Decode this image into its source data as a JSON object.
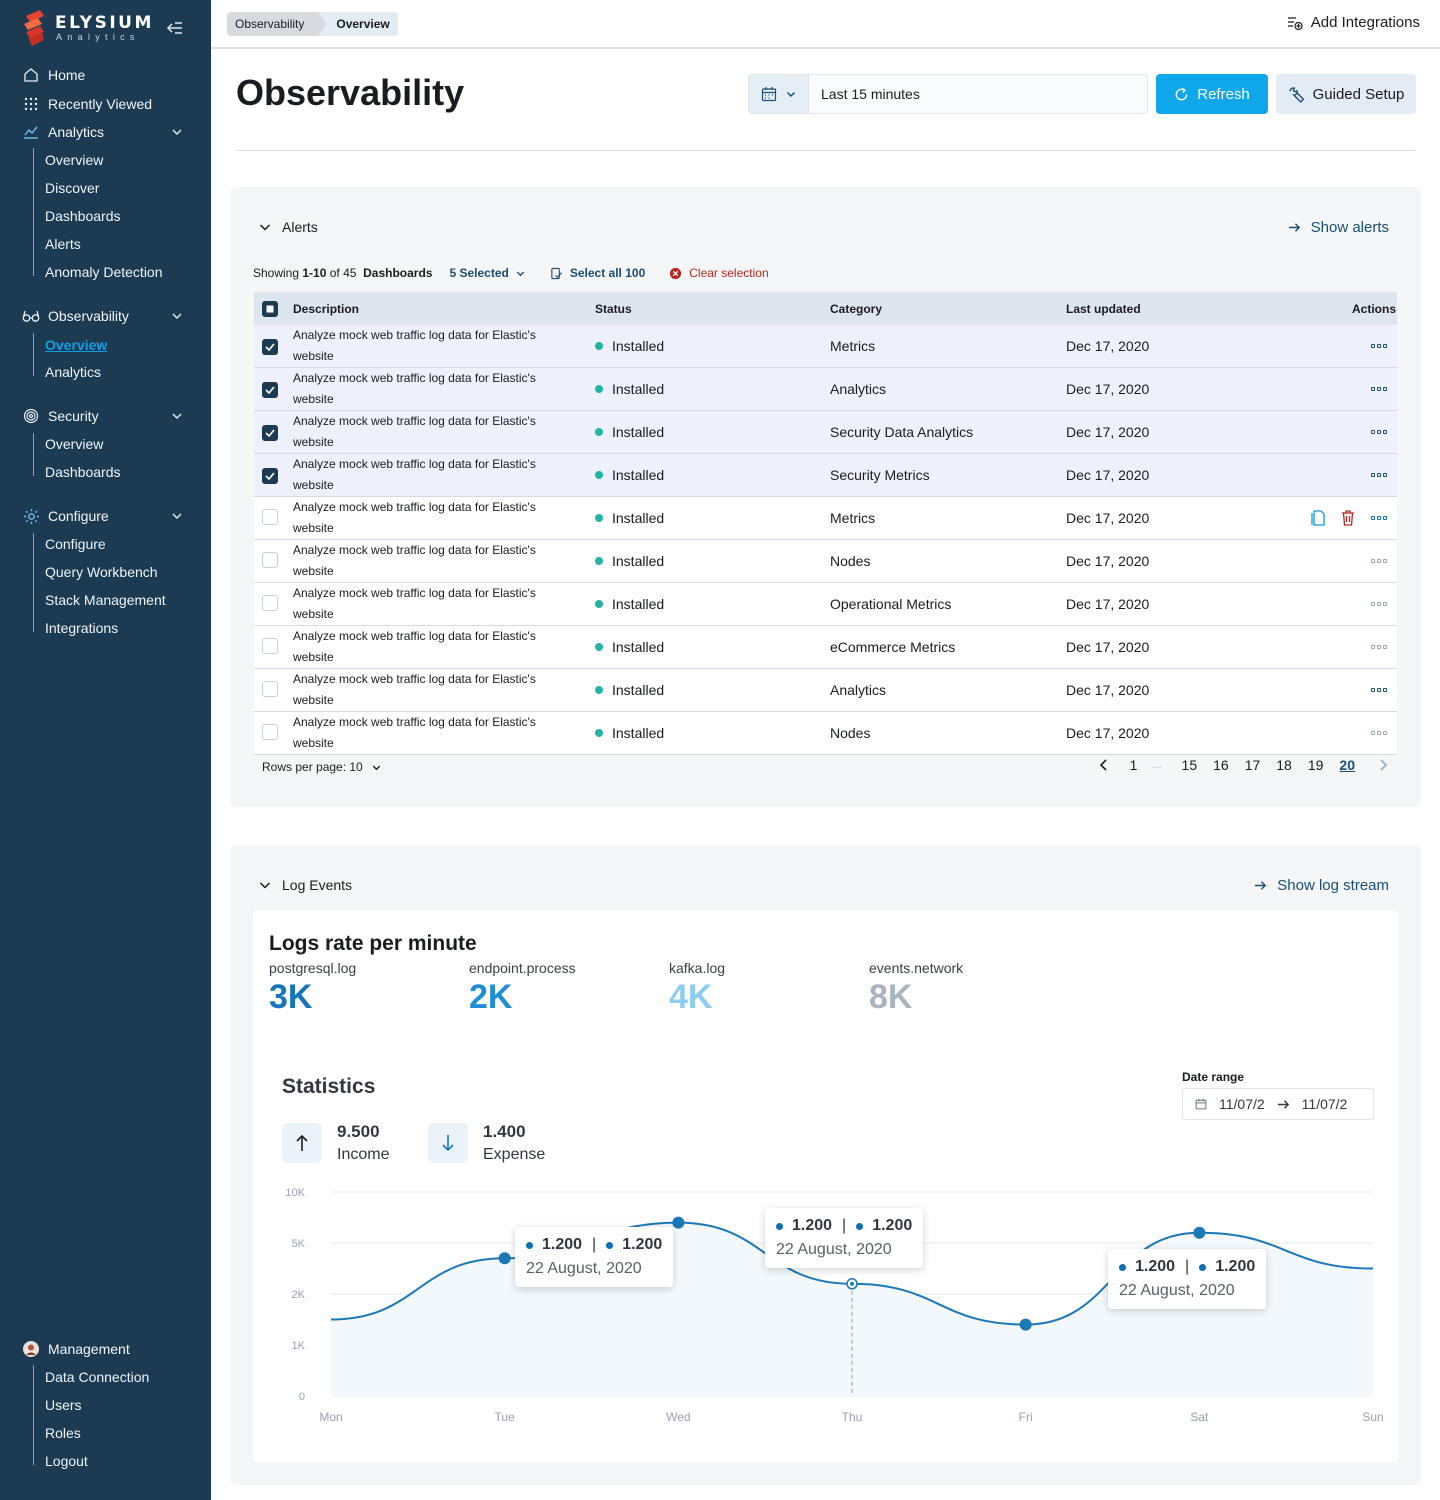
{
  "brand": {
    "name": "ELYSIUM",
    "sub": "Analytics"
  },
  "sidebar": {
    "home": "Home",
    "recent": "Recently Viewed",
    "analytics": {
      "label": "Analytics",
      "items": [
        "Overview",
        "Discover",
        "Dashboards",
        "Alerts",
        "Anomaly Detection"
      ]
    },
    "observability": {
      "label": "Observability",
      "items": [
        "Overview",
        "Analytics"
      ]
    },
    "security": {
      "label": "Security",
      "items": [
        "Overview",
        "Dashboards"
      ]
    },
    "configure": {
      "label": "Configure",
      "items": [
        "Configure",
        "Query Workbench",
        "Stack Management",
        "Integrations"
      ]
    },
    "management": {
      "label": "Management",
      "items": [
        "Data Connection",
        "Users",
        "Roles",
        "Logout"
      ]
    }
  },
  "topbar": {
    "crumbs": [
      "Observability",
      "Overview"
    ],
    "add_integrations": "Add Integrations"
  },
  "header": {
    "title": "Observability",
    "time_range": "Last 15 minutes",
    "refresh": "Refresh",
    "guided": "Guided Setup"
  },
  "alerts": {
    "title": "Alerts",
    "show_link": "Show alerts",
    "showing_prefix": "Showing",
    "showing_range": "1-10",
    "showing_of": "of 45",
    "dashboards": "Dashboards",
    "selected": "5 Selected",
    "select_all": "Select all 100",
    "clear": "Clear selection",
    "columns": [
      "Description",
      "Status",
      "Category",
      "Last updated",
      "Actions"
    ],
    "rows": [
      {
        "desc": "Analyze mock web traffic log data for Elastic's website",
        "status": "Installed",
        "category": "Metrics",
        "updated": "Dec 17, 2020",
        "checked": true
      },
      {
        "desc": "Analyze mock web traffic log data for Elastic's website",
        "status": "Installed",
        "category": "Analytics",
        "updated": "Dec 17, 2020",
        "checked": true
      },
      {
        "desc": "Analyze mock web traffic log data for Elastic's website",
        "status": "Installed",
        "category": "Security Data Analytics",
        "updated": "Dec 17, 2020",
        "checked": true
      },
      {
        "desc": "Analyze mock web traffic log data for Elastic's website",
        "status": "Installed",
        "category": "Security Metrics",
        "updated": "Dec 17, 2020",
        "checked": true
      },
      {
        "desc": "Analyze mock web traffic log data for Elastic's website",
        "status": "Installed",
        "category": "Metrics",
        "updated": "Dec 17, 2020",
        "checked": false
      },
      {
        "desc": "Analyze mock web traffic log data for Elastic's website",
        "status": "Installed",
        "category": "Nodes",
        "updated": "Dec 17, 2020",
        "checked": false
      },
      {
        "desc": "Analyze mock web traffic log data for Elastic's website",
        "status": "Installed",
        "category": "Operational Metrics",
        "updated": "Dec 17, 2020",
        "checked": false
      },
      {
        "desc": "Analyze mock web traffic log data for Elastic's website",
        "status": "Installed",
        "category": "eCommerce Metrics",
        "updated": "Dec 17, 2020",
        "checked": false
      },
      {
        "desc": "Analyze mock web traffic log data for Elastic's website",
        "status": "Installed",
        "category": "Analytics",
        "updated": "Dec 17, 2020",
        "checked": false
      },
      {
        "desc": "Analyze mock web traffic log data for Elastic's website",
        "status": "Installed",
        "category": "Nodes",
        "updated": "Dec 17, 2020",
        "checked": false
      }
    ],
    "rows_per_page": "Rows per page: 10",
    "pages": [
      "1",
      "...",
      "15",
      "16",
      "17",
      "18",
      "19",
      "20"
    ],
    "current_page": "20"
  },
  "logs": {
    "title": "Log Events",
    "show_link": "Show log stream",
    "card_title": "Logs rate per minute",
    "metrics": [
      {
        "label": "postgresql.log",
        "value": "3K",
        "color": "#1676b9"
      },
      {
        "label": "endpoint.process",
        "value": "2K",
        "color": "#1e8ed6"
      },
      {
        "label": "kafka.log",
        "value": "4K",
        "color": "#8ecdf2"
      },
      {
        "label": "events.network",
        "value": "8K",
        "color": "#a9b4bf"
      }
    ],
    "stats_title": "Statistics",
    "date_range_label": "Date range",
    "date_from": "11/07/2",
    "date_to": "11/07/2",
    "income_value": "9.500",
    "income_label": "Income",
    "expense_value": "1.400",
    "expense_label": "Expense"
  },
  "chart_data": {
    "type": "line",
    "categories": [
      "Mon",
      "Tue",
      "Wed",
      "Thu",
      "Fri",
      "Sat",
      "Sun"
    ],
    "y_ticks": [
      "10K",
      "5K",
      "2K",
      "1K",
      "0"
    ],
    "series": [
      {
        "values": [
          1.5,
          2.7,
          3.4,
          2.2,
          1.4,
          3.2,
          2.5
        ]
      }
    ],
    "tooltips": [
      {
        "v1": "1.200",
        "v2": "1.200",
        "date": "22 August, 2020"
      },
      {
        "v1": "1.200",
        "v2": "1.200",
        "date": "22 August, 2020"
      },
      {
        "v1": "1.200",
        "v2": "1.200",
        "date": "22 August, 2020"
      }
    ],
    "line_color": "#1a78b8"
  }
}
